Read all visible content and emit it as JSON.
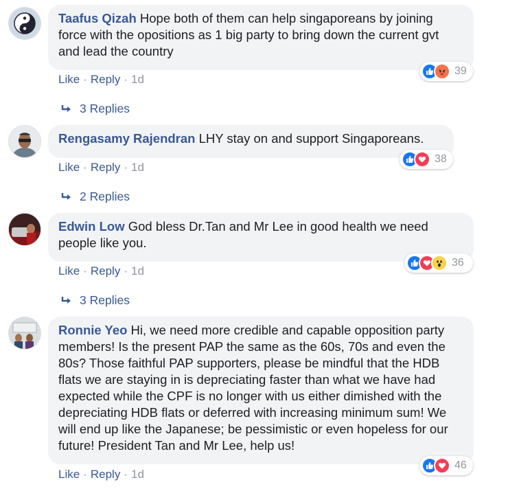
{
  "comments": [
    {
      "author": "Taafus Qizah",
      "text": "Hope both of them can help singaporeans by joining force with the opositions as 1 big party to bring down the current gvt and lead the country",
      "like": "Like",
      "reply": "Reply",
      "time": "1d",
      "reactions_count": "39",
      "reactions": [
        "like",
        "angry"
      ],
      "replies": "3 Replies"
    },
    {
      "author": "Rengasamy Rajendran",
      "text": "LHY stay on and support Singaporeans.",
      "like": "Like",
      "reply": "Reply",
      "time": "1d",
      "reactions_count": "38",
      "reactions": [
        "like",
        "love"
      ],
      "replies": "2 Replies"
    },
    {
      "author": "Edwin Low",
      "text": "God bless Dr.Tan and Mr Lee in good health we need people like you.",
      "like": "Like",
      "reply": "Reply",
      "time": "1d",
      "reactions_count": "36",
      "reactions": [
        "like",
        "love",
        "wow"
      ],
      "replies": "3 Replies"
    },
    {
      "author": "Ronnie Yeo",
      "text": "Hi, we need more credible and capable opposition party members! Is the present PAP the same as the 60s, 70s and even the 80s? Those faithful PAP supporters, please be mindful that the HDB flats we are staying in is depreciating faster than what we have had expected while the CPF is no longer with us either dimished with the depreciating HDB flats or deferred with increasing minimum sum! We will end up like the Japanese; be pessimistic or even hopeless for our future! President Tan and Mr Lee, help us!",
      "like": "Like",
      "reply": "Reply",
      "time": "1d",
      "reactions_count": "46",
      "reactions": [
        "like",
        "love"
      ]
    }
  ],
  "colors": {
    "author": "#385898",
    "bubble": "#f2f3f5",
    "meta": "#90949c",
    "like": "#1877f2",
    "love": "#f33e58",
    "angry": "#f7714b",
    "wow": "#fcd24b"
  }
}
